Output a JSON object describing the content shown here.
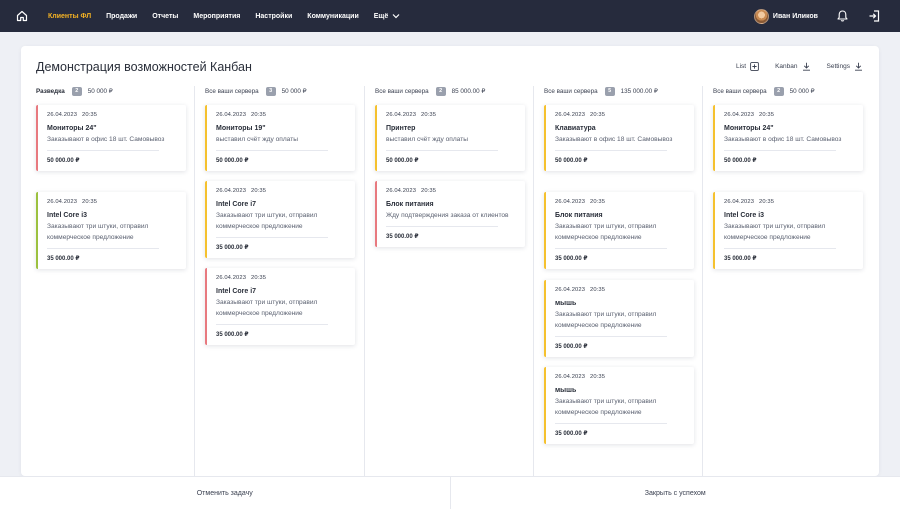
{
  "nav": {
    "items": [
      {
        "label": "Клиенты ФЛ",
        "active": true
      },
      {
        "label": "Продажи",
        "active": false
      },
      {
        "label": "Отчеты",
        "active": false
      },
      {
        "label": "Мероприятия",
        "active": false
      },
      {
        "label": "Настройки",
        "active": false
      },
      {
        "label": "Коммуникации",
        "active": false
      }
    ],
    "more_label": "Ещё",
    "user_name": "Иван Иликов",
    "icons": [
      "home-icon",
      "chevron-down-icon",
      "bell-icon",
      "logout-icon"
    ],
    "accent_color": "#f5b324"
  },
  "page": {
    "title": "Демонстрация возможностей Канбан",
    "views": [
      {
        "label": "List",
        "icon": "add-square-icon"
      },
      {
        "label": "Kanban",
        "icon": "download-icon"
      },
      {
        "label": "Settings",
        "icon": "download-icon"
      }
    ]
  },
  "columns": [
    {
      "name": "Разведка",
      "count": "2",
      "sum": "50 000 ₽",
      "cards": [
        {
          "date": "26.04.2023",
          "time": "20:35",
          "title": "Мониторы 24\"",
          "desc": "Заказывают в офис 18 шт. Самовывоз",
          "amount": "50 000.00 ₽",
          "color": "red"
        },
        {
          "date": "26.04.2023",
          "time": "20:35",
          "title": "Intel Core i3",
          "desc": "Заказывают три штуки, отправил коммерческое предложение",
          "amount": "35 000.00 ₽",
          "color": "green"
        }
      ]
    },
    {
      "name": "Все ваши сервера",
      "count": "3",
      "sum": "50 000 ₽",
      "cards": [
        {
          "date": "26.04.2023",
          "time": "20:35",
          "title": "Мониторы 19\"",
          "desc": "выставил счёт жду оплаты",
          "amount": "50 000.00 ₽",
          "color": "yellow"
        },
        {
          "date": "26.04.2023",
          "time": "20:35",
          "title": "Intel Core i7",
          "desc": "Заказывают три штуки, отправил коммерческое предложение",
          "amount": "35 000.00 ₽",
          "color": "yellow"
        },
        {
          "date": "26.04.2023",
          "time": "20:35",
          "title": "Intel Core i7",
          "desc": "Заказывают три штуки, отправил коммерческое предложение",
          "amount": "35 000.00 ₽",
          "color": "red"
        }
      ]
    },
    {
      "name": "Все ваши сервера",
      "count": "2",
      "sum": "85 000.00 ₽",
      "cards": [
        {
          "date": "26.04.2023",
          "time": "20:35",
          "title": "Принтер",
          "desc": "выставил счёт жду оплаты",
          "amount": "50 000.00 ₽",
          "color": "yellow"
        },
        {
          "date": "26.04.2023",
          "time": "20:35",
          "title": "Блок питания",
          "desc": "Жду подтверждения заказа от клиентов",
          "amount": "35 000.00 ₽",
          "color": "red"
        }
      ]
    },
    {
      "name": "Все ваши сервера",
      "count": "5",
      "sum": "135 000.00 ₽",
      "cards": [
        {
          "date": "26.04.2023",
          "time": "20:35",
          "title": "Клавиатура",
          "desc": "Заказывают в офис 18 шт. Самовывоз",
          "amount": "50 000.00 ₽",
          "color": "yellow"
        },
        {
          "date": "26.04.2023",
          "time": "20:35",
          "title": "Блок питания",
          "desc": "Заказывают три штуки, отправил коммерческое предложение",
          "amount": "35 000.00 ₽",
          "color": "yellow"
        },
        {
          "date": "26.04.2023",
          "time": "20:35",
          "title": "мышь",
          "desc": "Заказывают три штуки, отправил коммерческое предложение",
          "amount": "35 000.00 ₽",
          "color": "yellow"
        },
        {
          "date": "26.04.2023",
          "time": "20:35",
          "title": "мышь",
          "desc": "Заказывают три штуки, отправил коммерческое предложение",
          "amount": "35 000.00 ₽",
          "color": "yellow"
        }
      ]
    },
    {
      "name": "Все ваши сервера",
      "count": "2",
      "sum": "50 000 ₽",
      "cards": [
        {
          "date": "26.04.2023",
          "time": "20:35",
          "title": "Мониторы 24\"",
          "desc": "Заказывают в офис 18 шт. Самовывоз",
          "amount": "50 000.00 ₽",
          "color": "yellow"
        },
        {
          "date": "26.04.2023",
          "time": "20:35",
          "title": "Intel Core i3",
          "desc": "Заказывают три штуки, отправил коммерческое предложение",
          "amount": "35 000.00 ₽",
          "color": "yellow"
        }
      ]
    }
  ],
  "footer": {
    "cancel_label": "Отменить задачу",
    "close_label": "Закрыть с успехом"
  }
}
